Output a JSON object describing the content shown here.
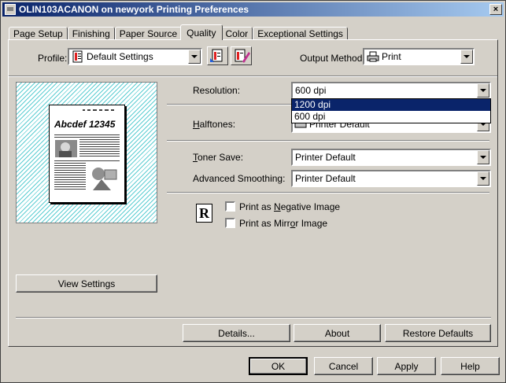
{
  "window": {
    "title": "OLIN103ACANON on newyork Printing Preferences",
    "close": "×"
  },
  "tabs": [
    {
      "label": "Page Setup",
      "active": false
    },
    {
      "label": "Finishing",
      "active": false
    },
    {
      "label": "Paper Source",
      "active": false
    },
    {
      "label": "Quality",
      "active": true
    },
    {
      "label": "Color",
      "active": false
    },
    {
      "label": "Exceptional Settings",
      "active": false
    }
  ],
  "profile": {
    "label": "Profile:",
    "value": "Default Settings"
  },
  "output_method": {
    "label": "Output Method:",
    "value": "Print"
  },
  "preview": {
    "sample_heading": "Abcdef 12345"
  },
  "resolution": {
    "label": "Resolution:",
    "value": "600 dpi",
    "options": [
      "1200 dpi",
      "600 dpi"
    ],
    "highlighted": "1200 dpi"
  },
  "halftones": {
    "label": "Halftones:",
    "value": "Printer Default"
  },
  "toner_save": {
    "label": "Toner Save:",
    "value": "Printer Default"
  },
  "advanced_smoothing": {
    "label": "Advanced Smoothing:",
    "value": "Printer Default"
  },
  "r_symbol": "R",
  "checkboxes": {
    "negative": {
      "label": "Print as Negative Image",
      "checked": false
    },
    "mirror": {
      "label": "Print as Mirror Image",
      "checked": false
    }
  },
  "buttons": {
    "view_settings": "View Settings",
    "details": "Details...",
    "about": "About",
    "restore_defaults": "Restore Defaults",
    "ok": "OK",
    "cancel": "Cancel",
    "apply": "Apply",
    "help": "Help"
  },
  "colors": {
    "title_start": "#0a246a",
    "title_end": "#a6caf0",
    "selection": "#0a246a",
    "hatch": "#5ccdd2"
  }
}
